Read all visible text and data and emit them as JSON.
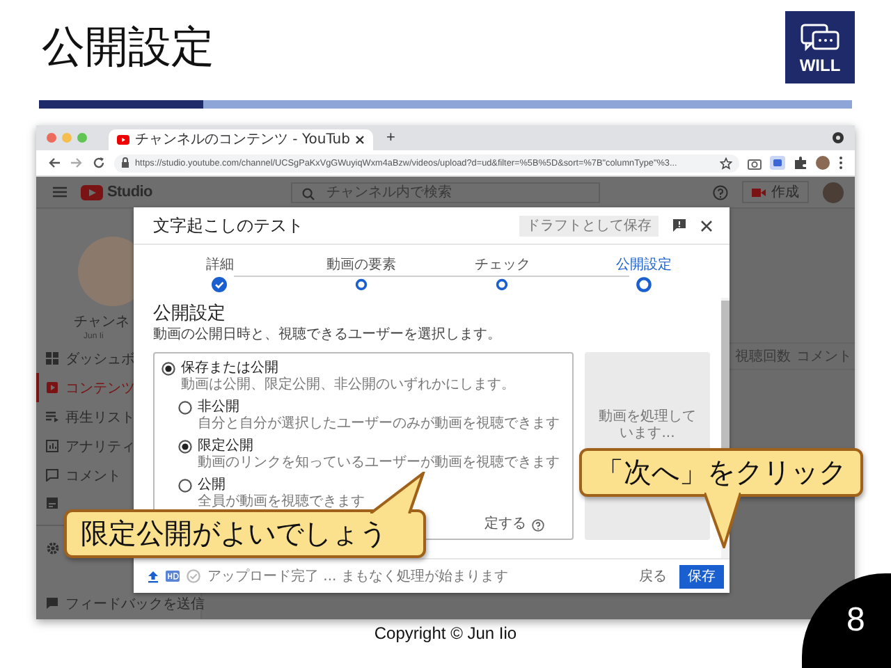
{
  "slide": {
    "title": "公開設定",
    "logo_text": "WILL",
    "copyright": "Copyright © Jun Iio",
    "page_number": "8"
  },
  "browser": {
    "tabs": [
      {
        "title": "チャンネルのコンテンツ - YouTub",
        "selected": true
      }
    ],
    "new_tab": "+",
    "url": "https://studio.youtube.com/channel/UCSgPaKxVgGWuyiqWxm4aBzw/videos/upload?d=ud&filter=%5B%5D&sort=%7B\"columnType\"%3..."
  },
  "studio": {
    "logo": "Studio",
    "search": {
      "placeholder": "チャンネル内で検索"
    },
    "create_button": "作成",
    "channel_name": "チャンネ",
    "channel_owner": "Jun Ii",
    "sidebar": [
      {
        "label": "ダッシュボ",
        "selected": false
      },
      {
        "label": "コンテンツ",
        "selected": true
      },
      {
        "label": "再生リスト",
        "selected": false
      },
      {
        "label": "アナリティ",
        "selected": false
      },
      {
        "label": "コメント",
        "selected": false
      }
    ],
    "feedback": "フィードバックを送信",
    "columns": [
      "視聴回数",
      "コメント"
    ]
  },
  "dialog": {
    "title": "文字起こしのテスト",
    "draft_button": "ドラフトとして保存",
    "steps": [
      {
        "label": "詳細",
        "kind": "done"
      },
      {
        "label": "動画の要素",
        "kind": "pending"
      },
      {
        "label": "チェック",
        "kind": "pending"
      },
      {
        "label": "公開設定",
        "kind": "active"
      }
    ],
    "heading": "公開設定",
    "description": "動画の公開日時と、視聴できるユーザーを選択します。",
    "options": [
      {
        "label": "保存または公開",
        "description": "動画は公開、限定公開、非公開のいずれかにします。",
        "selected": true,
        "children": [
          {
            "label": "非公開",
            "description": "自分と自分が選択したユーザーのみが動画を視聴できます",
            "selected": false
          },
          {
            "label": "限定公開",
            "description": "動画のリンクを知っているユーザーが動画を視聴できます",
            "selected": true
          },
          {
            "label": "公開",
            "description": "全員が動画を視聴できます",
            "selected": false
          }
        ]
      }
    ],
    "premiere_text": "定する",
    "preview_text": "動画を処理しています...",
    "status_text": "アップロード完了 ... まもなく処理が始まります",
    "back_button": "戻る",
    "save_button": "保存"
  },
  "callouts": [
    {
      "text": "限定公開がよいでしょう",
      "kind": "up"
    },
    {
      "text": "「次へ」をクリック",
      "kind": "down"
    }
  ]
}
